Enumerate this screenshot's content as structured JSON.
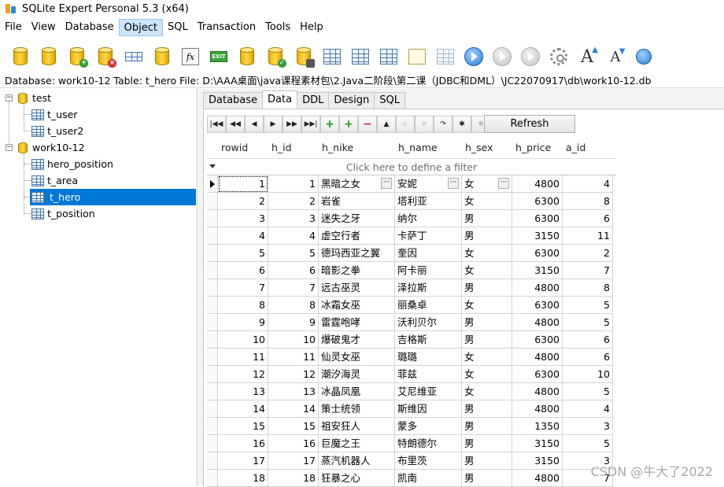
{
  "window": {
    "title": "SQLite Expert Personal 5.3 (x64)"
  },
  "menu": [
    "File",
    "View",
    "Database",
    "Object",
    "SQL",
    "Transaction",
    "Tools",
    "Help"
  ],
  "toolbar": {
    "exit_label": "EXIT",
    "fx_label": "fx",
    "font_a": "A"
  },
  "pathbar": {
    "text": "Database: work10-12   Table: t_hero   File: D:\\AAA桌面\\java课程素材包\\2.Java二阶段\\第二课（JDBC和DML）\\JC22070917\\db\\work10-12.db"
  },
  "tree": {
    "databases": [
      {
        "name": "test",
        "tables": [
          "t_user",
          "t_user2"
        ]
      },
      {
        "name": "work10-12",
        "tables": [
          "hero_position",
          "t_area",
          "t_hero",
          "t_position"
        ]
      }
    ],
    "selected_table": "t_hero"
  },
  "tabs": [
    "Database",
    "Data",
    "DDL",
    "Design",
    "SQL"
  ],
  "active_tab": "Data",
  "refresh_label": "Refresh",
  "grid": {
    "columns": [
      "rowid",
      "h_id",
      "h_nike",
      "h_name",
      "h_sex",
      "h_price",
      "a_id"
    ],
    "filter_placeholder": "Click here to define a filter",
    "rows": [
      [
        "1",
        "1",
        "黑暗之女",
        "安妮",
        "女",
        "4800",
        "4"
      ],
      [
        "2",
        "2",
        "岩雀",
        "塔利亚",
        "女",
        "6300",
        "8"
      ],
      [
        "3",
        "3",
        "迷失之牙",
        "纳尔",
        "男",
        "6300",
        "6"
      ],
      [
        "4",
        "4",
        "虚空行者",
        "卡萨丁",
        "男",
        "3150",
        "11"
      ],
      [
        "5",
        "5",
        "德玛西亚之翼",
        "奎因",
        "女",
        "6300",
        "2"
      ],
      [
        "6",
        "6",
        "暗影之拳",
        "阿卡丽",
        "女",
        "3150",
        "7"
      ],
      [
        "7",
        "7",
        "远古巫灵",
        "泽拉斯",
        "男",
        "4800",
        "8"
      ],
      [
        "8",
        "8",
        "冰霜女巫",
        "丽桑卓",
        "女",
        "6300",
        "5"
      ],
      [
        "9",
        "9",
        "雷霆咆哮",
        "沃利贝尔",
        "男",
        "4800",
        "5"
      ],
      [
        "10",
        "10",
        "爆破鬼才",
        "吉格斯",
        "男",
        "6300",
        "6"
      ],
      [
        "11",
        "11",
        "仙灵女巫",
        "璐璐",
        "女",
        "4800",
        "6"
      ],
      [
        "12",
        "12",
        "潮汐海灵",
        "菲兹",
        "女",
        "6300",
        "10"
      ],
      [
        "13",
        "13",
        "冰晶凤凰",
        "艾尼维亚",
        "女",
        "4800",
        "5"
      ],
      [
        "14",
        "14",
        "策士统领",
        "斯维因",
        "男",
        "4800",
        "4"
      ],
      [
        "15",
        "15",
        "祖安狂人",
        "蒙多",
        "男",
        "1350",
        "3"
      ],
      [
        "16",
        "16",
        "巨魔之王",
        "特朗德尔",
        "男",
        "3150",
        "5"
      ],
      [
        "17",
        "17",
        "蒸汽机器人",
        "布里茨",
        "男",
        "3150",
        "3"
      ],
      [
        "18",
        "18",
        "狂暴之心",
        "凯南",
        "男",
        "4800",
        "7"
      ]
    ]
  },
  "watermark": "CSDN @牛大了2022"
}
